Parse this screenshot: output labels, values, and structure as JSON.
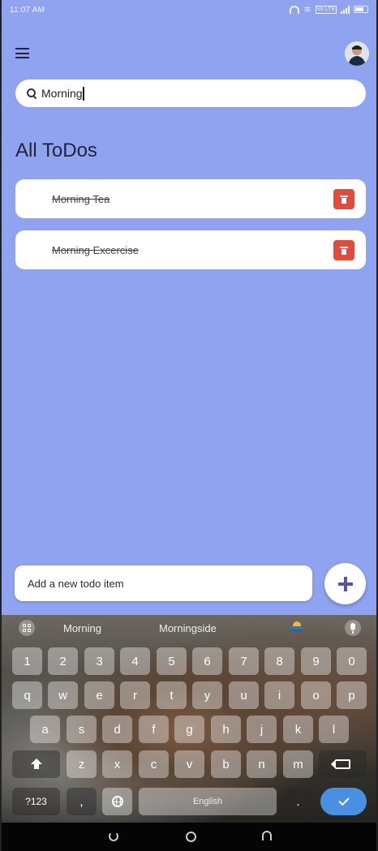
{
  "status": {
    "time": "11:07 AM",
    "network_tag": "Vo LTE"
  },
  "search": {
    "value": "Morning"
  },
  "heading": "All ToDos",
  "todos": [
    {
      "title": "Morning Tea",
      "done": true
    },
    {
      "title": "Morning Excercise",
      "done": true
    }
  ],
  "add": {
    "placeholder": "Add a new todo item"
  },
  "keyboard": {
    "suggestions": [
      "Morning",
      "Morningside"
    ],
    "row1": [
      "1",
      "2",
      "3",
      "4",
      "5",
      "6",
      "7",
      "8",
      "9",
      "0"
    ],
    "row2": [
      "q",
      "w",
      "e",
      "r",
      "t",
      "y",
      "u",
      "i",
      "o",
      "p"
    ],
    "row3": [
      "a",
      "s",
      "d",
      "f",
      "g",
      "h",
      "j",
      "k",
      "l"
    ],
    "row4": [
      "z",
      "x",
      "c",
      "v",
      "b",
      "n",
      "m"
    ],
    "symbols_label": "?123",
    "comma_label": ",",
    "space_label": "English",
    "period_label": "."
  },
  "colors": {
    "background": "#8fa3f1",
    "delete": "#e24a3b",
    "accent": "#5b51a8",
    "enter": "#4a90e2"
  },
  "icons": [
    "menu-icon",
    "avatar",
    "search-icon",
    "trash-icon",
    "plus-icon",
    "apps-icon",
    "sunrise-icon",
    "mic-icon",
    "shift-icon",
    "backspace-icon",
    "globe-icon",
    "check-icon"
  ]
}
